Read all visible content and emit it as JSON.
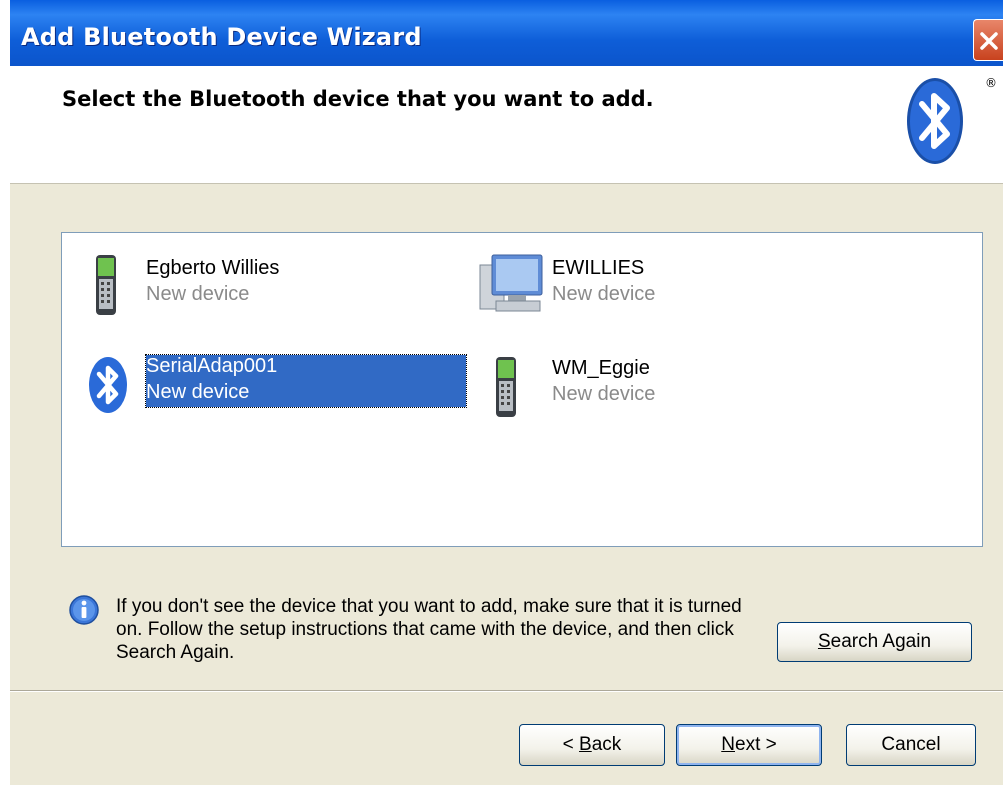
{
  "window": {
    "title": "Add Bluetooth Device Wizard",
    "close_label": "Close"
  },
  "header": {
    "heading": "Select the Bluetooth device that you want to add.",
    "logo_icon": "bluetooth-logo-icon",
    "registered_mark": "®"
  },
  "devices": [
    {
      "name": "Egberto Willies",
      "status": "New device",
      "icon": "mobile-phone-icon",
      "selected": false
    },
    {
      "name": "EWILLIES",
      "status": "New device",
      "icon": "computer-icon",
      "selected": false
    },
    {
      "name": "SerialAdap001",
      "status": "New device",
      "icon": "bluetooth-device-icon",
      "selected": true
    },
    {
      "name": "WM_Eggie",
      "status": "New device",
      "icon": "mobile-phone-icon",
      "selected": false
    }
  ],
  "info": {
    "icon": "info-icon",
    "text": "If you don't see the device that you want to add, make sure that it is turned on. Follow the setup instructions that came with the device, and then click Search Again."
  },
  "buttons": {
    "search_again": {
      "prefix": "",
      "accel": "S",
      "rest": "earch Again"
    },
    "back": {
      "prefix": "< ",
      "accel": "B",
      "rest": "ack"
    },
    "next": {
      "prefix": "",
      "accel": "N",
      "rest": "ext >"
    },
    "cancel": {
      "label": "Cancel"
    }
  },
  "colors": {
    "titlebar": "#0a5fe0",
    "selection": "#316ac5",
    "dialog_bg": "#ece9d8"
  }
}
